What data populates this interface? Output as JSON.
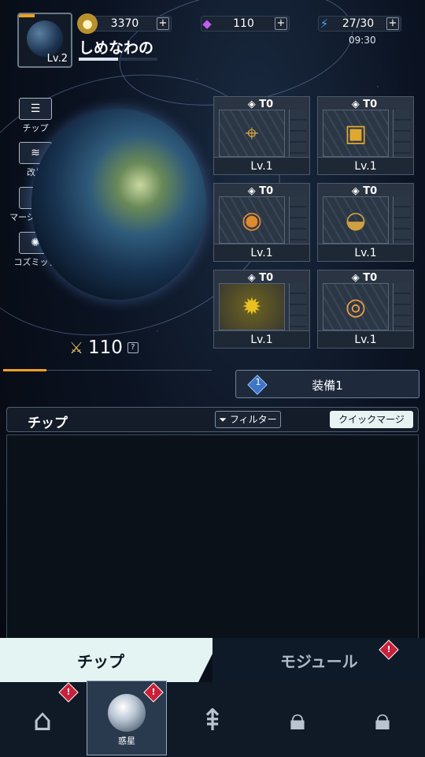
{
  "player": {
    "name": "しめなわの",
    "level": "Lv.2",
    "xp_fraction": 0.5
  },
  "resources": {
    "gold": {
      "value": "3370",
      "icon": "gold-coin-icon"
    },
    "gems": {
      "value": "110",
      "icon": "purple-gem-icon"
    },
    "energy": {
      "value": "27/30",
      "icon": "lightning-icon"
    },
    "energy_timer": "09:30",
    "plus": "+"
  },
  "side_menu": [
    {
      "label": "チップ",
      "icon": "list-icon"
    },
    {
      "label": "改良",
      "icon": "rank-chevron-icon"
    },
    {
      "label": "マージチップ",
      "icon": "merge-icon"
    },
    {
      "label": "コズミック",
      "icon": "galaxy-icon"
    }
  ],
  "power": {
    "value": "110",
    "help": "?"
  },
  "chip_slots": [
    {
      "tier": "T0",
      "level": "Lv.1",
      "icon": "cannon-turret-icon"
    },
    {
      "tier": "T0",
      "level": "Lv.1",
      "icon": "gold-cube-icon"
    },
    {
      "tier": "T0",
      "level": "Lv.1",
      "icon": "thruster-engine-icon"
    },
    {
      "tier": "T0",
      "level": "Lv.1",
      "icon": "satellite-dish-icon"
    },
    {
      "tier": "T0",
      "level": "Lv.1",
      "icon": "spiked-orb-icon"
    },
    {
      "tier": "T0",
      "level": "Lv.1",
      "icon": "reactor-core-icon"
    }
  ],
  "equip": {
    "number": "1",
    "label": "装備1"
  },
  "chip_panel": {
    "title": "チップ",
    "filter": "フィルター",
    "quick_merge": "クイックマージ"
  },
  "tabs": {
    "chip": "チップ",
    "module": "モジュール",
    "alert": "!"
  },
  "nav": [
    {
      "caption": "",
      "icon": "shop-icon",
      "alert": true
    },
    {
      "caption": "惑星",
      "icon": "planet-sphere-icon",
      "alert": true
    },
    {
      "caption": "",
      "icon": "fleet-rockets-icon",
      "alert": false
    },
    {
      "caption": "",
      "icon": "lock-icon",
      "alert": false
    },
    {
      "caption": "",
      "icon": "lock-icon",
      "alert": false
    }
  ],
  "colors": {
    "accent": "#f0a020",
    "alert": "#c9203a",
    "tab_active": "#e3f4f2"
  }
}
